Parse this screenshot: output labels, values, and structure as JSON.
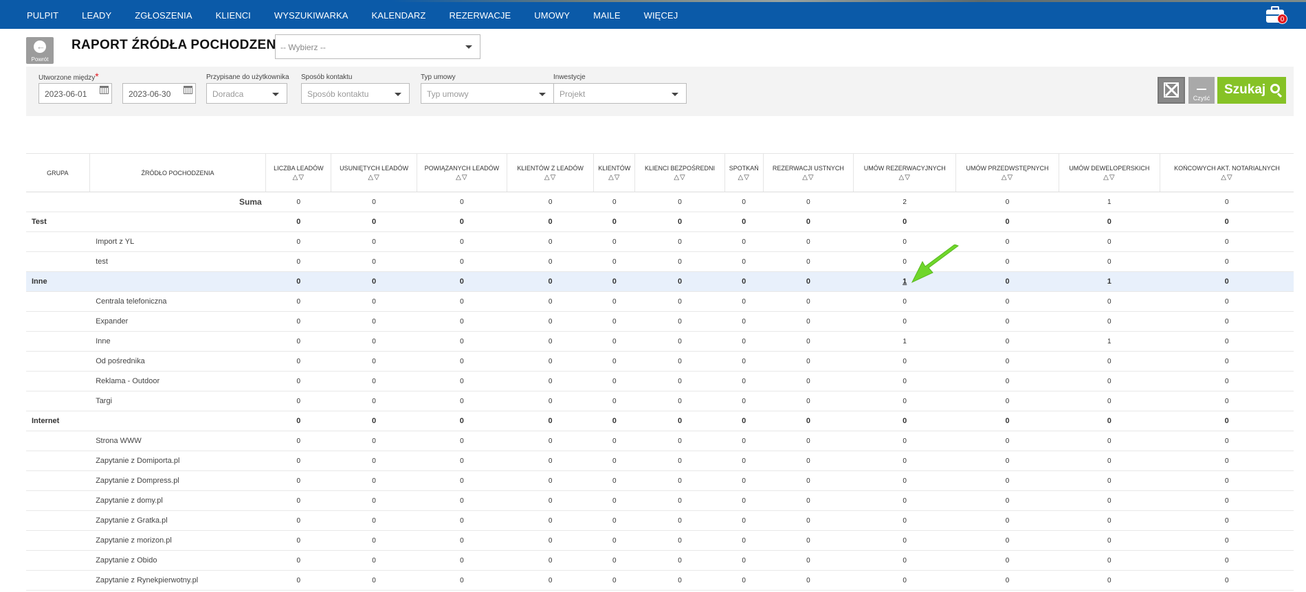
{
  "nav": {
    "items": [
      "PULPIT",
      "LEADY",
      "ZGŁOSZENIA",
      "KLIENCI",
      "WYSZUKIWARKA",
      "KALENDARZ",
      "REZERWACJE",
      "UMOWY",
      "MAILE",
      "WIĘCEJ"
    ],
    "cart_count": "0"
  },
  "header": {
    "back_label": "Powrót",
    "title": "RAPORT ŹRÓDŁA POCHODZENIA",
    "report_select_placeholder": "-- Wybierz --"
  },
  "filters": {
    "created_label": "Utworzone między",
    "date_from": "2023-06-01",
    "date_to": "2023-06-30",
    "assigned_label": "Przypisane do użytkownika",
    "assigned_value": "Doradca",
    "contact_label": "Sposób kontaktu",
    "contact_value": "Sposób kontaktu",
    "contract_type_label": "Typ umowy",
    "contract_type_value": "Typ umowy",
    "investments_label": "Inwestycje",
    "investments_value": "Projekt",
    "clear_label": "Czyść",
    "search_label": "Szukaj"
  },
  "table": {
    "headers": [
      "GRUPA",
      "ŹRÓDŁO POCHODZENIA",
      "LICZBA LEADÓW",
      "USUNIĘTYCH LEADÓW",
      "POWIĄZANYCH LEADÓW",
      "KLIENTÓW Z LEADÓW",
      "KLIENTÓW",
      "KLIENCI BEZPOŚREDNI",
      "SPOTKAŃ",
      "REZERWACJI USTNYCH",
      "UMÓW REZERWACYJNYCH",
      "UMÓW PRZEDWSTĘPNYCH",
      "UMÓW DEWELOPERSKICH",
      "KOŃCOWYCH AKT. NOTARIALNYCH"
    ],
    "sort_glyph": "△▽",
    "rows": [
      {
        "kind": "sum",
        "group": "",
        "source": "Suma",
        "values": [
          "0",
          "0",
          "0",
          "0",
          "0",
          "0",
          "0",
          "0",
          "2",
          "0",
          "1",
          "0"
        ]
      },
      {
        "kind": "group",
        "group": "Test",
        "source": "",
        "values": [
          "0",
          "0",
          "0",
          "0",
          "0",
          "0",
          "0",
          "0",
          "0",
          "0",
          "0",
          "0"
        ]
      },
      {
        "kind": "item",
        "group": "",
        "source": "Import z YL",
        "values": [
          "0",
          "0",
          "0",
          "0",
          "0",
          "0",
          "0",
          "0",
          "0",
          "0",
          "0",
          "0"
        ]
      },
      {
        "kind": "item",
        "group": "",
        "source": "test",
        "values": [
          "0",
          "0",
          "0",
          "0",
          "0",
          "0",
          "0",
          "0",
          "0",
          "0",
          "0",
          "0"
        ]
      },
      {
        "kind": "group",
        "group": "Inne",
        "source": "",
        "highlight": true,
        "link_col": 8,
        "values": [
          "0",
          "0",
          "0",
          "0",
          "0",
          "0",
          "0",
          "0",
          "1",
          "0",
          "1",
          "0"
        ]
      },
      {
        "kind": "item",
        "group": "",
        "source": "Centrala telefoniczna",
        "values": [
          "0",
          "0",
          "0",
          "0",
          "0",
          "0",
          "0",
          "0",
          "0",
          "0",
          "0",
          "0"
        ]
      },
      {
        "kind": "item",
        "group": "",
        "source": "Expander",
        "values": [
          "0",
          "0",
          "0",
          "0",
          "0",
          "0",
          "0",
          "0",
          "0",
          "0",
          "0",
          "0"
        ]
      },
      {
        "kind": "item",
        "group": "",
        "source": "Inne",
        "values": [
          "0",
          "0",
          "0",
          "0",
          "0",
          "0",
          "0",
          "0",
          "1",
          "0",
          "1",
          "0"
        ]
      },
      {
        "kind": "item",
        "group": "",
        "source": "Od pośrednika",
        "values": [
          "0",
          "0",
          "0",
          "0",
          "0",
          "0",
          "0",
          "0",
          "0",
          "0",
          "0",
          "0"
        ]
      },
      {
        "kind": "item",
        "group": "",
        "source": "Reklama - Outdoor",
        "values": [
          "0",
          "0",
          "0",
          "0",
          "0",
          "0",
          "0",
          "0",
          "0",
          "0",
          "0",
          "0"
        ]
      },
      {
        "kind": "item",
        "group": "",
        "source": "Targi",
        "values": [
          "0",
          "0",
          "0",
          "0",
          "0",
          "0",
          "0",
          "0",
          "0",
          "0",
          "0",
          "0"
        ]
      },
      {
        "kind": "group",
        "group": "Internet",
        "source": "",
        "values": [
          "0",
          "0",
          "0",
          "0",
          "0",
          "0",
          "0",
          "0",
          "0",
          "0",
          "0",
          "0"
        ]
      },
      {
        "kind": "item",
        "group": "",
        "source": "Strona WWW",
        "values": [
          "0",
          "0",
          "0",
          "0",
          "0",
          "0",
          "0",
          "0",
          "0",
          "0",
          "0",
          "0"
        ]
      },
      {
        "kind": "item",
        "group": "",
        "source": "Zapytanie z Domiporta.pl",
        "values": [
          "0",
          "0",
          "0",
          "0",
          "0",
          "0",
          "0",
          "0",
          "0",
          "0",
          "0",
          "0"
        ]
      },
      {
        "kind": "item",
        "group": "",
        "source": "Zapytanie z Dompress.pl",
        "values": [
          "0",
          "0",
          "0",
          "0",
          "0",
          "0",
          "0",
          "0",
          "0",
          "0",
          "0",
          "0"
        ]
      },
      {
        "kind": "item",
        "group": "",
        "source": "Zapytanie z domy.pl",
        "values": [
          "0",
          "0",
          "0",
          "0",
          "0",
          "0",
          "0",
          "0",
          "0",
          "0",
          "0",
          "0"
        ]
      },
      {
        "kind": "item",
        "group": "",
        "source": "Zapytanie z Gratka.pl",
        "values": [
          "0",
          "0",
          "0",
          "0",
          "0",
          "0",
          "0",
          "0",
          "0",
          "0",
          "0",
          "0"
        ]
      },
      {
        "kind": "item",
        "group": "",
        "source": "Zapytanie z morizon.pl",
        "values": [
          "0",
          "0",
          "0",
          "0",
          "0",
          "0",
          "0",
          "0",
          "0",
          "0",
          "0",
          "0"
        ]
      },
      {
        "kind": "item",
        "group": "",
        "source": "Zapytanie z Obido",
        "values": [
          "0",
          "0",
          "0",
          "0",
          "0",
          "0",
          "0",
          "0",
          "0",
          "0",
          "0",
          "0"
        ]
      },
      {
        "kind": "item",
        "group": "",
        "source": "Zapytanie z Rynekpierwotny.pl",
        "values": [
          "0",
          "0",
          "0",
          "0",
          "0",
          "0",
          "0",
          "0",
          "0",
          "0",
          "0",
          "0"
        ]
      }
    ]
  },
  "colors": {
    "nav_bg": "#0b5aa8",
    "search_btn": "#86c226",
    "highlight_row": "#e8f0fb",
    "annotation_arrow": "#6fd62a",
    "badge": "#e0171f"
  }
}
